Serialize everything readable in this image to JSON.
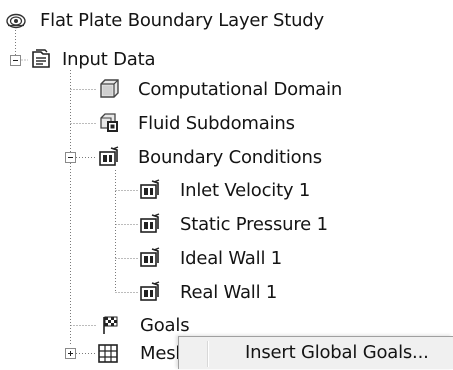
{
  "tree": {
    "root": {
      "label": "Flat Plate Boundary Layer Study",
      "icon": "project-icon"
    },
    "input_data": {
      "label": "Input Data",
      "icon": "input-data-icon",
      "expanded": true
    },
    "computational_domain": {
      "label": "Computational Domain",
      "icon": "computational-domain-icon"
    },
    "fluid_subdomains": {
      "label": "Fluid Subdomains",
      "icon": "fluid-subdomains-icon"
    },
    "boundary_conditions": {
      "label": "Boundary Conditions",
      "icon": "boundary-conditions-icon",
      "expanded": true
    },
    "inlet_velocity": {
      "label": "Inlet Velocity 1",
      "icon": "boundary-condition-icon"
    },
    "static_pressure": {
      "label": "Static Pressure 1",
      "icon": "boundary-condition-icon"
    },
    "ideal_wall": {
      "label": "Ideal Wall 1",
      "icon": "boundary-condition-icon"
    },
    "real_wall": {
      "label": "Real Wall 1",
      "icon": "boundary-condition-icon"
    },
    "goals": {
      "label": "Goals",
      "icon": "goals-flag-icon"
    },
    "mesh": {
      "label": "Mesh",
      "icon": "mesh-icon",
      "expanded": false
    }
  },
  "context_menu": {
    "items": [
      {
        "label": "Insert Global Goals..."
      }
    ]
  }
}
